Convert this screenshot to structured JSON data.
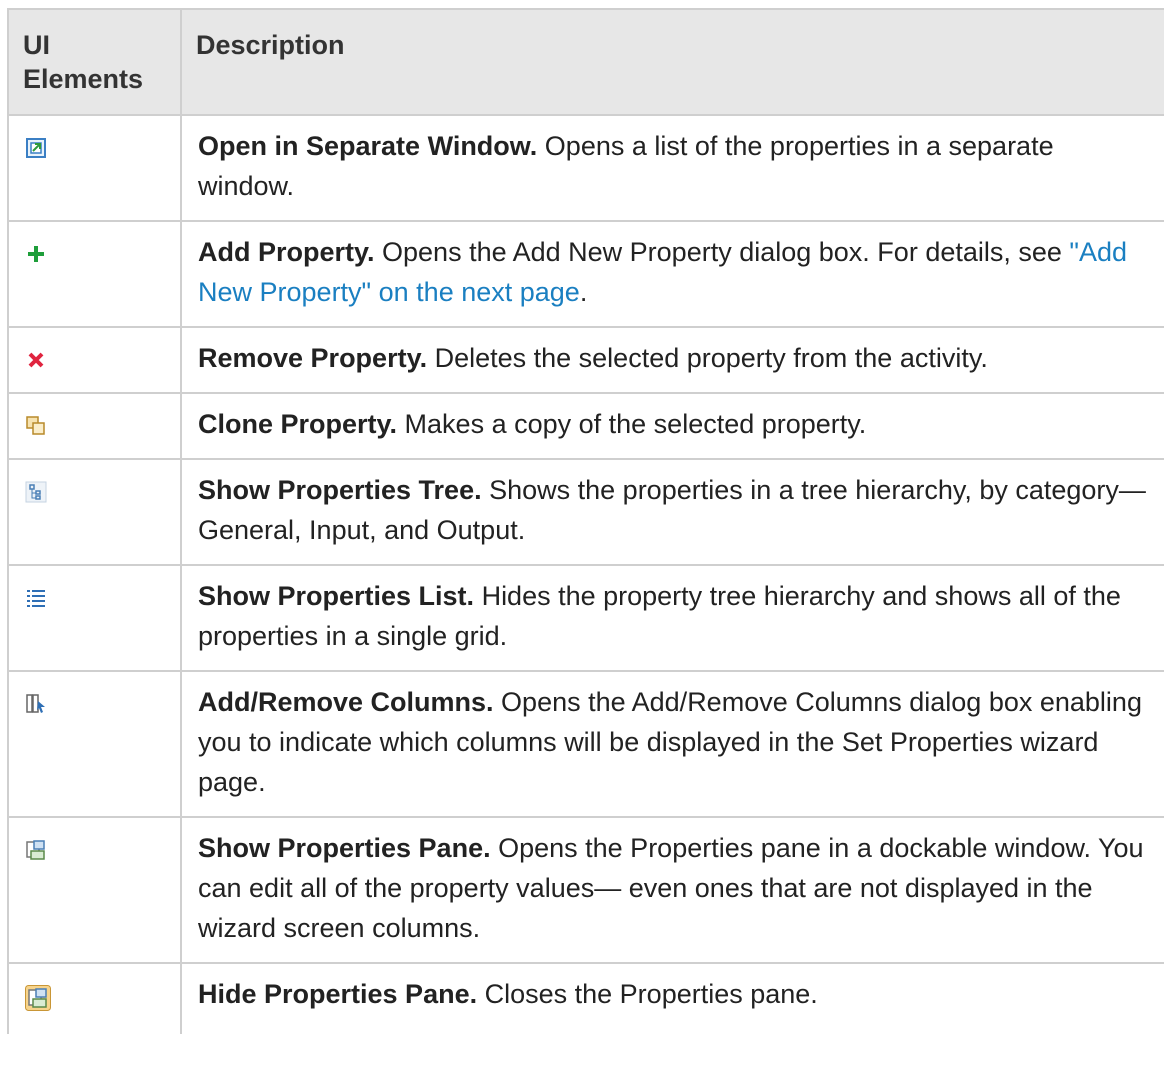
{
  "header": {
    "col1": "UI Elements",
    "col2": "Description"
  },
  "rows": [
    {
      "icon": "open-separate-window-icon",
      "title": "Open in Separate Window.",
      "desc": " Opens a list of the properties in a separate window."
    },
    {
      "icon": "add-icon",
      "title": "Add Property.",
      "desc": " Opens the Add New Property dialog box. For details, see ",
      "link": "\"Add New Property\" on the next page",
      "after": "."
    },
    {
      "icon": "remove-icon",
      "title": "Remove Property.",
      "desc": " Deletes the selected property from the activity."
    },
    {
      "icon": "clone-icon",
      "title": "Clone Property.",
      "desc": " Makes a copy of the selected property."
    },
    {
      "icon": "tree-icon",
      "title": "Show Properties Tree.",
      "desc": " Shows the properties in a tree hierarchy, by category—General, Input, and Output."
    },
    {
      "icon": "list-icon",
      "title": "Show Properties List.",
      "desc": " Hides the property tree hierarchy and shows all of the properties in a single grid."
    },
    {
      "icon": "columns-icon",
      "title": "Add/Remove Columns.",
      "desc": " Opens the Add/Remove Columns dialog box enabling you to indicate which columns will be displayed in the Set Properties wizard page."
    },
    {
      "icon": "show-pane-icon",
      "title": "Show Properties Pane.",
      "desc": " Opens the Properties pane in a dockable window. You can edit all of the property values— even ones that are not displayed in the wizard screen columns."
    },
    {
      "icon": "hide-pane-icon",
      "title": "Hide Properties Pane.",
      "desc": " Closes the Properties pane."
    }
  ]
}
